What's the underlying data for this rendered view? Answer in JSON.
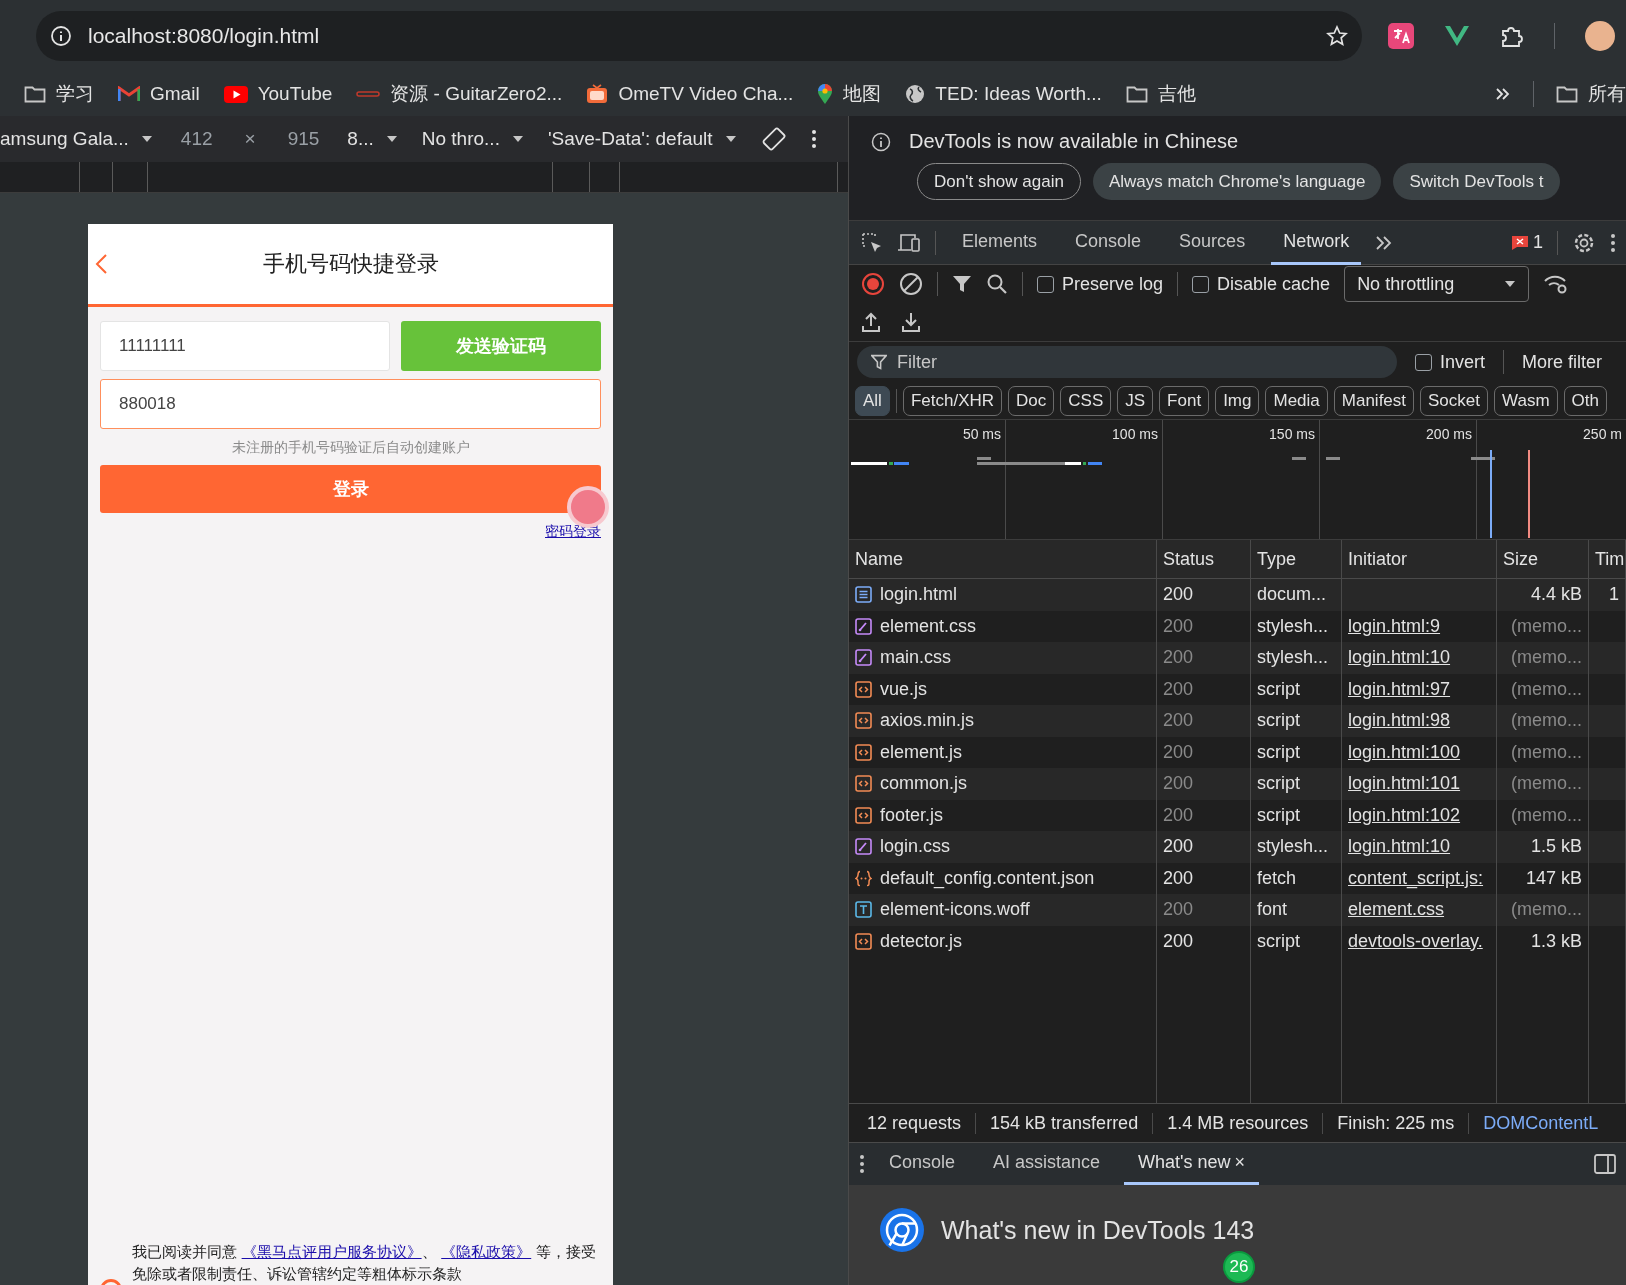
{
  "browser": {
    "url": "localhost:8080/login.html",
    "bookmarks": [
      {
        "label": "学习",
        "kind": "folder"
      },
      {
        "label": "Gmail",
        "kind": "gmail"
      },
      {
        "label": "YouTube",
        "kind": "youtube"
      },
      {
        "label": "资源 - GuitarZero2...",
        "kind": "site"
      },
      {
        "label": "OmeTV Video Cha...",
        "kind": "tv"
      },
      {
        "label": "地图",
        "kind": "maps"
      },
      {
        "label": "TED: Ideas Worth...",
        "kind": "globe"
      },
      {
        "label": "吉他",
        "kind": "folder"
      }
    ],
    "all_bookmarks": "所有"
  },
  "device_toolbar": [
    {
      "label": "amsung Gala...",
      "kind": "dropdown"
    },
    {
      "label": "412",
      "kind": "field"
    },
    {
      "label": "×",
      "kind": "text"
    },
    {
      "label": "915",
      "kind": "field"
    },
    {
      "label": "8...",
      "kind": "dropdown"
    },
    {
      "label": "No thro...",
      "kind": "dropdown"
    },
    {
      "label": "'Save-Data': default",
      "kind": "dropdown"
    }
  ],
  "login_page": {
    "title": "手机号码快捷登录",
    "phone": {
      "value": "11111111",
      "focused": false
    },
    "send_code": "发送验证码",
    "code": {
      "value": "880018",
      "focused": true
    },
    "hint": "未注册的手机号码验证后自动创建账户",
    "login_button": "登录",
    "password_login": "密码登录",
    "agreement": {
      "checked": false,
      "parts": [
        {
          "text": "我已阅读并同意 ",
          "kind": "text"
        },
        {
          "text": "《黑马点评用户服务协议》",
          "kind": "link"
        },
        {
          "text": "、 ",
          "kind": "text"
        },
        {
          "text": "《隐私政策》",
          "kind": "link"
        },
        {
          "text": " 等，接受免除或者限制责任、诉讼管辖约定等粗体标示条款",
          "kind": "text"
        }
      ]
    }
  },
  "devtools": {
    "infobar": {
      "message": "DevTools is now available in Chinese",
      "buttons": [
        {
          "label": "Don't show again",
          "kind": "outline"
        },
        {
          "label": "Always match Chrome's language",
          "kind": "filled"
        },
        {
          "label": "Switch DevTools t",
          "kind": "filled"
        }
      ]
    },
    "tabs": [
      {
        "label": "Elements",
        "selected": false
      },
      {
        "label": "Console",
        "selected": false
      },
      {
        "label": "Sources",
        "selected": false
      },
      {
        "label": "Network",
        "selected": true
      }
    ],
    "error_count": "1",
    "toolbar": {
      "recording": true,
      "preserve_log": {
        "label": "Preserve log",
        "checked": false
      },
      "disable_cache": {
        "label": "Disable cache",
        "checked": false
      },
      "throttling": "No throttling"
    },
    "filter": {
      "placeholder": "Filter",
      "invert": {
        "label": "Invert",
        "checked": false
      },
      "more_filters": "More filter"
    },
    "type_filters": [
      {
        "label": "All",
        "selected": true
      },
      {
        "label": "Fetch/XHR",
        "selected": false
      },
      {
        "label": "Doc",
        "selected": false
      },
      {
        "label": "CSS",
        "selected": false
      },
      {
        "label": "JS",
        "selected": false
      },
      {
        "label": "Font",
        "selected": false
      },
      {
        "label": "Img",
        "selected": false
      },
      {
        "label": "Media",
        "selected": false
      },
      {
        "label": "Manifest",
        "selected": false
      },
      {
        "label": "Socket",
        "selected": false
      },
      {
        "label": "Wasm",
        "selected": false
      },
      {
        "label": "Oth",
        "selected": false
      }
    ],
    "timeline": {
      "ticks": [
        "50 ms",
        "100 ms",
        "150 ms",
        "200 ms",
        "250 m"
      ]
    },
    "table": {
      "columns": [
        "Name",
        "Status",
        "Type",
        "Initiator",
        "Size",
        "Tim"
      ],
      "rows": [
        {
          "name": "login.html",
          "kind": "doc",
          "status": "200",
          "dimmed": false,
          "type": "docum...",
          "size": "4.4 kB",
          "time": "1"
        },
        {
          "name": "element.css",
          "kind": "css",
          "status": "200",
          "dimmed": true,
          "type": "stylesh...",
          "initiator": "login.html:9",
          "size": "(memo..."
        },
        {
          "name": "main.css",
          "kind": "css",
          "status": "200",
          "dimmed": true,
          "type": "stylesh...",
          "initiator": "login.html:10",
          "size": "(memo..."
        },
        {
          "name": "vue.js",
          "kind": "script",
          "status": "200",
          "dimmed": true,
          "type": "script",
          "initiator": "login.html:97",
          "size": "(memo..."
        },
        {
          "name": "axios.min.js",
          "kind": "script",
          "status": "200",
          "dimmed": true,
          "type": "script",
          "initiator": "login.html:98",
          "size": "(memo..."
        },
        {
          "name": "element.js",
          "kind": "script",
          "status": "200",
          "dimmed": true,
          "type": "script",
          "initiator": "login.html:100",
          "size": "(memo..."
        },
        {
          "name": "common.js",
          "kind": "script",
          "status": "200",
          "dimmed": true,
          "type": "script",
          "initiator": "login.html:101",
          "size": "(memo..."
        },
        {
          "name": "footer.js",
          "kind": "script",
          "status": "200",
          "dimmed": true,
          "type": "script",
          "initiator": "login.html:102",
          "size": "(memo..."
        },
        {
          "name": "login.css",
          "kind": "css",
          "status": "200",
          "dimmed": false,
          "type": "stylesh...",
          "initiator": "login.html:10",
          "size": "1.5 kB"
        },
        {
          "name": "default_config.content.json",
          "kind": "fetch",
          "status": "200",
          "dimmed": false,
          "type": "fetch",
          "initiator": "content_script.js:",
          "size": "147 kB"
        },
        {
          "name": "element-icons.woff",
          "kind": "font",
          "status": "200",
          "dimmed": true,
          "type": "font",
          "initiator": "element.css",
          "size": "(memo..."
        },
        {
          "name": "detector.js",
          "kind": "script",
          "status": "200",
          "dimmed": false,
          "type": "script",
          "initiator": "devtools-overlay.",
          "size": "1.3 kB"
        }
      ]
    },
    "summary": [
      {
        "text": "12 requests",
        "kind": "plain"
      },
      {
        "text": "154 kB transferred",
        "kind": "plain"
      },
      {
        "text": "1.4 MB resources",
        "kind": "plain"
      },
      {
        "text": "Finish: 225 ms",
        "kind": "plain"
      },
      {
        "text": "DOMContentL",
        "kind": "event"
      }
    ],
    "drawer_tabs": [
      {
        "label": "Console",
        "selected": false
      },
      {
        "label": "AI assistance",
        "selected": false
      },
      {
        "label": "What's new",
        "selected": true,
        "close": "×"
      }
    ],
    "whats_new": {
      "title": "What's new in DevTools 143",
      "badge": "26"
    }
  }
}
